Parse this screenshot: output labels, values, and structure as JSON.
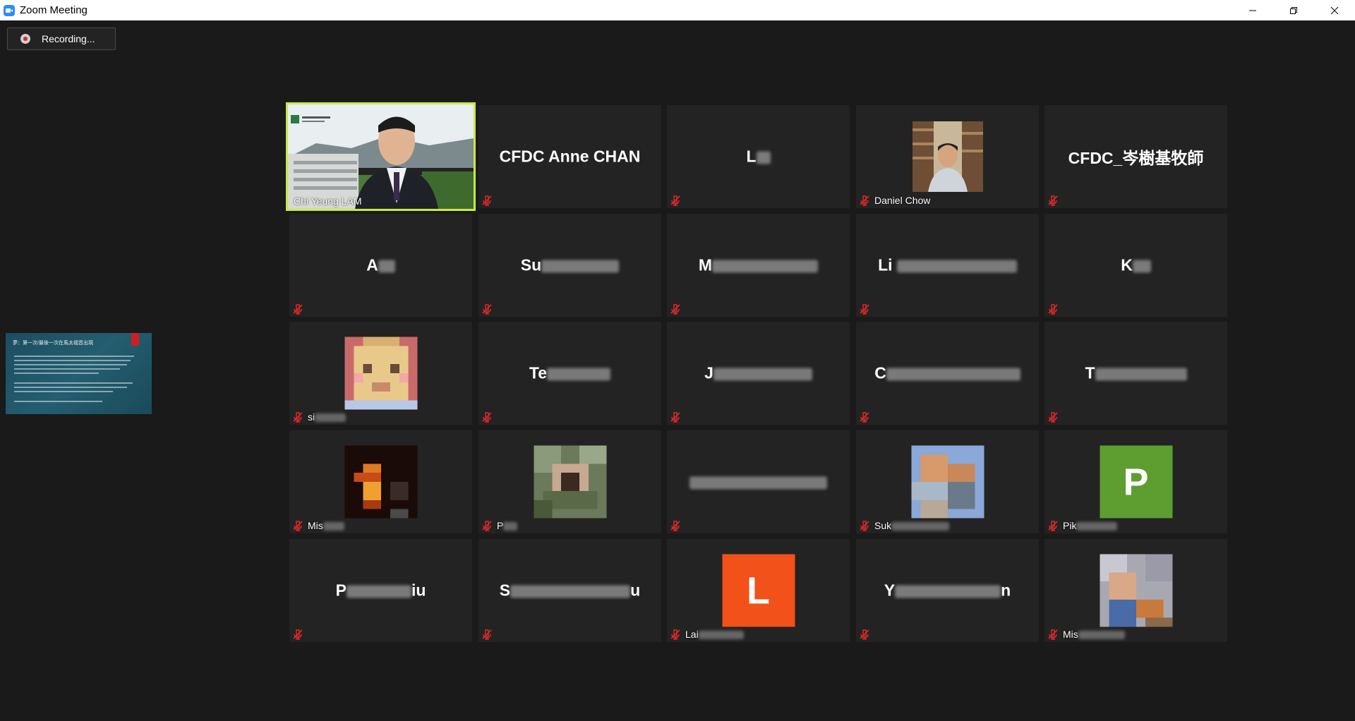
{
  "window": {
    "title": "Zoom Meeting",
    "minimize_icon": "minimize-icon",
    "restore_icon": "restore-icon",
    "close_icon": "close-icon"
  },
  "recording": {
    "label": "Recording...",
    "icon": "record-icon"
  },
  "share_thumbnail": {
    "title": "夢：第一次/最後一次在馬太福音出現"
  },
  "colors": {
    "active_speaker_border": "#c8e84a",
    "tile_bg": "#232323",
    "mute_red": "#e02828",
    "avatar_green": "#5e9e30",
    "avatar_orange": "#f2511a"
  },
  "participants": [
    {
      "display": "",
      "label": "Chi Yeung LAM",
      "type": "video",
      "active": true,
      "muted": false
    },
    {
      "display": "CFDC Anne CHAN",
      "label": "",
      "type": "name",
      "muted": true
    },
    {
      "display": "L",
      "label": "",
      "type": "name",
      "muted": true
    },
    {
      "display": "",
      "label": "Daniel Chow",
      "type": "video-small",
      "muted": true
    },
    {
      "display": "CFDC_岑樹基牧師",
      "label": "",
      "type": "name",
      "muted": true
    },
    {
      "display": "A",
      "label": "",
      "type": "name",
      "muted": true
    },
    {
      "display": "Su",
      "label": "",
      "type": "name",
      "muted": true
    },
    {
      "display": "M",
      "label": "",
      "type": "name",
      "muted": true
    },
    {
      "display": "Li",
      "label": "",
      "type": "name",
      "muted": true
    },
    {
      "display": "K",
      "label": "",
      "type": "name",
      "muted": true
    },
    {
      "display": "",
      "label": "si",
      "type": "photo",
      "muted": true
    },
    {
      "display": "Te",
      "label": "",
      "type": "name",
      "muted": true
    },
    {
      "display": "J",
      "label": "",
      "type": "name",
      "muted": true
    },
    {
      "display": "C",
      "label": "",
      "type": "name",
      "muted": true
    },
    {
      "display": "T",
      "label": "",
      "type": "name",
      "muted": true
    },
    {
      "display": "",
      "label": "Mis",
      "type": "photo",
      "muted": true
    },
    {
      "display": "",
      "label": "P",
      "type": "photo",
      "muted": true
    },
    {
      "display": "",
      "label": "",
      "type": "name",
      "muted": true
    },
    {
      "display": "",
      "label": "Suk",
      "type": "photo",
      "muted": true
    },
    {
      "display": "P",
      "label": "Pik",
      "type": "letter",
      "muted": true
    },
    {
      "display": "P",
      "label": "",
      "type": "name",
      "muted": true
    },
    {
      "display": "S",
      "label": "",
      "type": "name",
      "muted": true
    },
    {
      "display": "L",
      "label": "Lai",
      "type": "letter",
      "muted": true
    },
    {
      "display": "Y",
      "label": "",
      "type": "name",
      "muted": true
    },
    {
      "display": "",
      "label": "Mis",
      "type": "photo",
      "muted": true
    }
  ]
}
